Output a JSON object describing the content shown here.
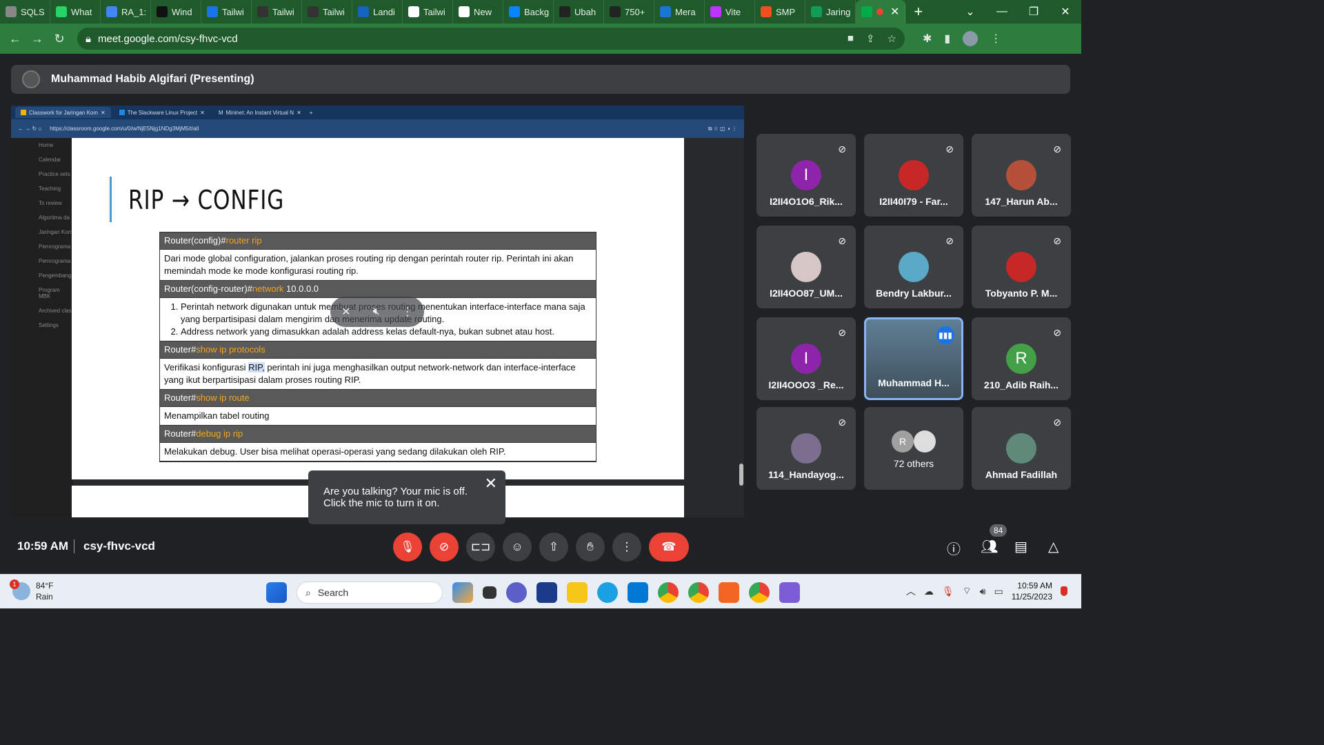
{
  "browser": {
    "tabs": [
      {
        "label": "SQLS",
        "color": "#888888"
      },
      {
        "label": "What",
        "color": "#25d366"
      },
      {
        "label": "RA_1:",
        "color": "#4285f4"
      },
      {
        "label": "Wind",
        "color": "#111111"
      },
      {
        "label": "Tailwi",
        "color": "#1a73e8"
      },
      {
        "label": "Tailwi",
        "color": "#333333"
      },
      {
        "label": "Tailwi",
        "color": "#333333"
      },
      {
        "label": "Landi",
        "color": "#1565c0"
      },
      {
        "label": "Tailwi",
        "color": "#ffffff"
      },
      {
        "label": "New",
        "color": "#ffffff"
      },
      {
        "label": "Backg",
        "color": "#0b84ff"
      },
      {
        "label": "Ubah",
        "color": "#222222"
      },
      {
        "label": "750+",
        "color": "#222222"
      },
      {
        "label": "Mera",
        "color": "#1976d2"
      },
      {
        "label": "Vite",
        "color": "#bd34fe"
      },
      {
        "label": "SMP",
        "color": "#f24e1e"
      },
      {
        "label": "Jaring",
        "color": "#0f9d58"
      }
    ],
    "url": "meet.google.com/csy-fhvc-vcd"
  },
  "meet": {
    "presenter": "Muhammad Habib Algifari (Presenting)",
    "time": "10:59 AM",
    "code": "csy-fhvc-vcd",
    "tooltip": {
      "line1": "Are you talking? Your mic is off.",
      "line2": "Click the mic to turn it on."
    },
    "participant_count": "84",
    "participants": [
      {
        "name": "I2II4O1O6_Rik...",
        "initial": "I",
        "color": "#8e24aa"
      },
      {
        "name": "I2II40I79 - Far...",
        "initial": "",
        "color": "#c62828"
      },
      {
        "name": "147_Harun Ab...",
        "initial": "",
        "color": "#b5503a"
      },
      {
        "name": "I2II4OO87_UM...",
        "initial": "",
        "color": "#d7c6c6"
      },
      {
        "name": "Bendry Lakbur...",
        "initial": "",
        "color": "#5aa9c7"
      },
      {
        "name": "Tobyanto P. M...",
        "initial": "",
        "color": "#c62828"
      },
      {
        "name": "I2II4OOO3 _Re...",
        "initial": "I",
        "color": "#8e24aa"
      },
      {
        "name": "Muhammad H...",
        "initial": "",
        "color": "#5f7f95"
      },
      {
        "name": "210_Adib Raih...",
        "initial": "R",
        "color": "#43a047"
      },
      {
        "name": "114_Handayog...",
        "initial": "",
        "color": "#7b6e8e"
      },
      {
        "name": "72 others",
        "initial": "R",
        "color": "#a0a0a0"
      },
      {
        "name": "Ahmad Fadillah",
        "initial": "",
        "color": "#5f8a7a"
      }
    ]
  },
  "shared_screen": {
    "inner_tabs": [
      "Classwork for Jaringan Kom",
      "The Slackware Linux Project",
      "Mininet: An Instant Virtual N"
    ],
    "inner_url": "https://classroom.google.com/u/0/w/NjE5Njg1NDg3MjM5/t/all",
    "sidebar": [
      "Home",
      "Calendar",
      "Practice sets",
      "Teaching",
      "To review",
      "Algoritma da",
      "Jaringan Kom",
      "Pemrograma",
      "Pemrograma",
      "Pengembang",
      "Program MBK",
      "Archived clas",
      "Settings"
    ],
    "slide_title": "RIP → CONFIG",
    "rows": [
      {
        "prefix": "Router(config)#",
        "cmd": "router rip",
        "arg": "",
        "desc": "Dari mode global configuration, jalankan proses routing rip dengan perintah router rip. Perintah ini akan memindah mode ke mode konfigurasi routing rip."
      },
      {
        "prefix": "Router(config-router)#",
        "cmd": "network",
        "arg": " 10.0.0.0",
        "desc": ""
      },
      {
        "prefix": "Router#",
        "cmd": "show ip protocols",
        "arg": "",
        "desc_pre": "Verifikasi konfigurasi ",
        "desc_hl": "RIP,",
        "desc_post": " perintah ini juga menghasilkan output network-network dan interface-interface yang ikut berpartisipasi dalam proses routing RIP."
      },
      {
        "prefix": "Router#",
        "cmd": "show ip route",
        "arg": "",
        "desc": "Menampilkan tabel routing"
      },
      {
        "prefix": "Router#",
        "cmd": "debug ip rip",
        "arg": "",
        "desc": "Melakukan debug. User bisa melihat operasi-operasi yang sedang dilakukan oleh RIP."
      }
    ],
    "network_items": [
      "Perintah network digunakan untuk membuat proses routing menentukan interface-interface mana saja yang berpartisipasi dalam mengirim dan menerima update routing.",
      "Address network yang dimasukkan adalah address kelas default-nya, bukan subnet atau host."
    ]
  },
  "taskbar": {
    "temp": "84°F",
    "weather": "Rain",
    "weather_badge": "1",
    "search_placeholder": "Search",
    "clock_time": "10:59 AM",
    "clock_date": "11/25/2023"
  },
  "icons": {
    "mic_off": "mic-off-icon",
    "cam_off": "camera-off-icon",
    "captions": "captions-icon",
    "emoji": "emoji-icon",
    "present": "present-icon",
    "hand": "raise-hand-icon",
    "more": "more-vert-icon",
    "hangup": "hangup-icon",
    "info": "info-icon",
    "people": "people-icon",
    "chat": "chat-icon",
    "activities": "activities-icon"
  }
}
